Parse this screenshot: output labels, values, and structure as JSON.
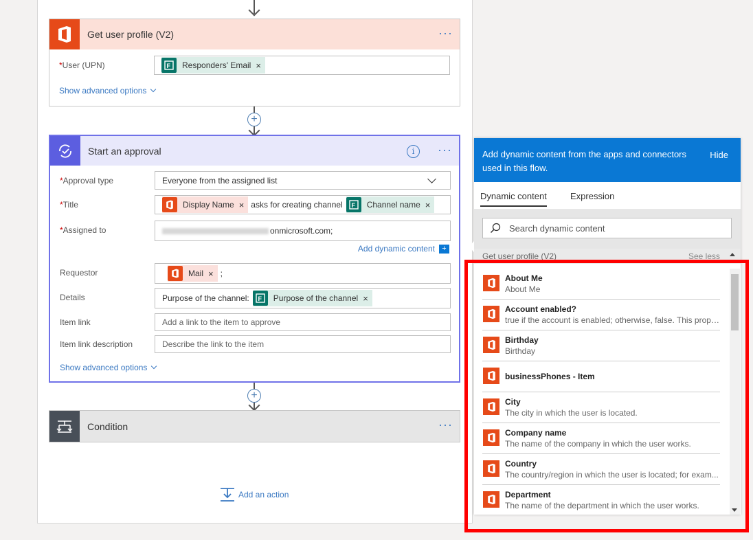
{
  "flow": {
    "get_profile": {
      "title": "Get user profile (V2)",
      "user_label": "User (UPN)",
      "user_token": "Responders' Email",
      "advanced": "Show advanced options"
    },
    "approval": {
      "title": "Start an approval",
      "approval_type_label": "Approval type",
      "approval_type_value": "Everyone from the assigned list",
      "title_label": "Title",
      "title_token1": "Display Name",
      "title_text": "asks for creating channel",
      "title_token2": "Channel name",
      "assigned_label": "Assigned to",
      "assigned_value": "onmicrosoft.com;",
      "add_dynamic": "Add dynamic content",
      "requestor_label": "Requestor",
      "requestor_token": "Mail",
      "requestor_suffix": ";",
      "details_label": "Details",
      "details_text": "Purpose of the channel:",
      "details_token": "Purpose of the channel",
      "item_link_label": "Item link",
      "item_link_placeholder": "Add a link to the item to approve",
      "item_link_desc_label": "Item link description",
      "item_link_desc_placeholder": "Describe the link to the item",
      "advanced": "Show advanced options"
    },
    "condition": {
      "title": "Condition"
    },
    "add_action": "Add an action"
  },
  "dynamic_panel": {
    "header": "Add dynamic content from the apps and connectors used in this flow.",
    "hide": "Hide",
    "tabs": [
      "Dynamic content",
      "Expression"
    ],
    "search_placeholder": "Search dynamic content",
    "section_title": "Get user profile (V2)",
    "see_less": "See less",
    "items": [
      {
        "name": "About Me",
        "desc": "About Me"
      },
      {
        "name": "Account enabled?",
        "desc": "true if the account is enabled; otherwise, false. This prope..."
      },
      {
        "name": "Birthday",
        "desc": "Birthday"
      },
      {
        "name": "businessPhones - Item",
        "desc": ""
      },
      {
        "name": "City",
        "desc": "The city in which the user is located."
      },
      {
        "name": "Company name",
        "desc": "The name of the company in which the user works."
      },
      {
        "name": "Country",
        "desc": "The country/region in which the user is located; for exam..."
      },
      {
        "name": "Department",
        "desc": "The name of the department in which the user works."
      }
    ]
  },
  "colors": {
    "office_red": "#e64a19",
    "forms_green": "#077568",
    "approval_purple": "#5c5ee0",
    "accent_blue": "#0a78d4",
    "highlight_red": "#ff0000"
  }
}
